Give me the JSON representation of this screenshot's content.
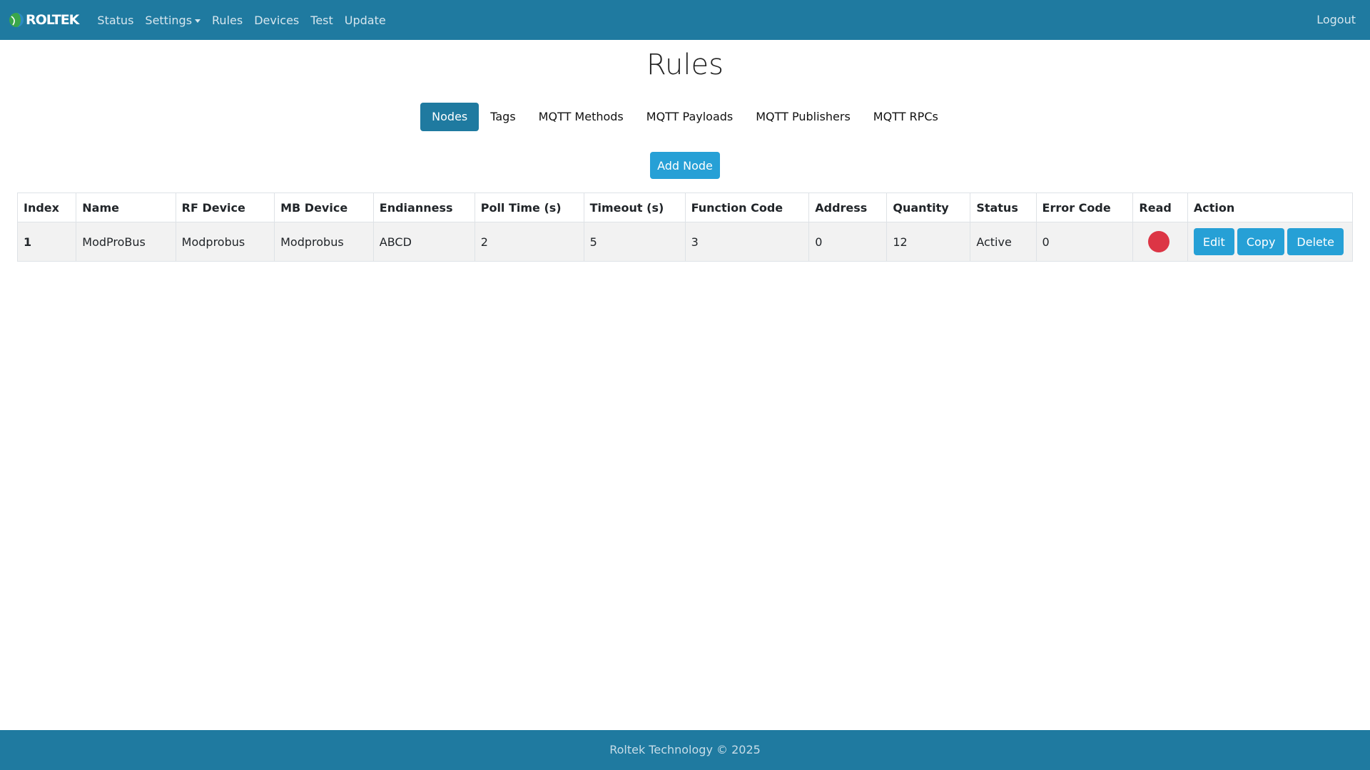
{
  "navbar": {
    "brand": "ROLTEK",
    "items": [
      "Status",
      "Settings",
      "Rules",
      "Devices",
      "Test",
      "Update"
    ],
    "logout": "Logout",
    "colors": {
      "background": "#1f7aa0"
    }
  },
  "page": {
    "title": "Rules"
  },
  "tabs": [
    {
      "label": "Nodes",
      "active": true
    },
    {
      "label": "Tags",
      "active": false
    },
    {
      "label": "MQTT Methods",
      "active": false
    },
    {
      "label": "MQTT Payloads",
      "active": false
    },
    {
      "label": "MQTT Publishers",
      "active": false
    },
    {
      "label": "MQTT RPCs",
      "active": false
    }
  ],
  "add_button": "Add Node",
  "table": {
    "headers": [
      "Index",
      "Name",
      "RF Device",
      "MB Device",
      "Endianness",
      "Poll Time (s)",
      "Timeout (s)",
      "Function Code",
      "Address",
      "Quantity",
      "Status",
      "Error Code",
      "Read",
      "Action"
    ],
    "rows": [
      {
        "index": "1",
        "name": "ModProBus",
        "rf_device": "Modprobus",
        "mb_device": "Modprobus",
        "endianness": "ABCD",
        "poll_time": "2",
        "timeout": "5",
        "function_code": "3",
        "address": "0",
        "quantity": "12",
        "status": "Active",
        "error_code": "0",
        "read_indicator_color": "#dc3545",
        "actions": {
          "edit": "Edit",
          "copy": "Copy",
          "delete": "Delete"
        }
      }
    ]
  },
  "footer": {
    "text": "Roltek Technology © 2025"
  }
}
